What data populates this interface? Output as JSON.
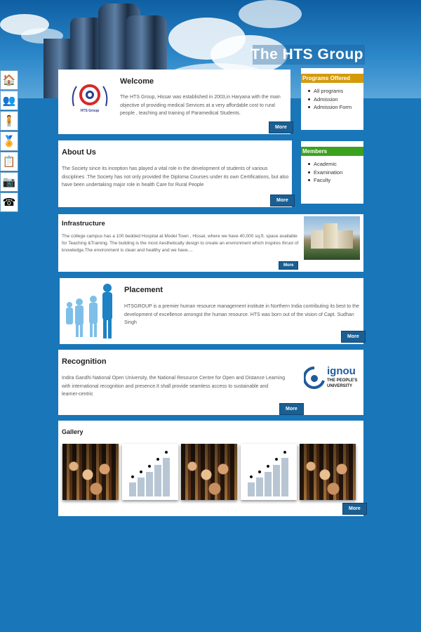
{
  "site": {
    "title": "The HTS Group"
  },
  "left_nav": [
    {
      "icon": "home-icon",
      "glyph": "🏠"
    },
    {
      "icon": "people-icon",
      "glyph": "👥"
    },
    {
      "icon": "person-icon",
      "glyph": "🧍"
    },
    {
      "icon": "award-icon",
      "glyph": "🏅"
    },
    {
      "icon": "clipboard-icon",
      "glyph": "📋"
    },
    {
      "icon": "camera-icon",
      "glyph": "📷"
    },
    {
      "icon": "phone-icon",
      "glyph": "☎"
    }
  ],
  "welcome": {
    "heading": "Welcome",
    "logo_text": "HTS Group",
    "text": "The HTS Group, Hissar was established in 2003,in Haryana with the main objective of providing medical Services at a very affordable cost to rural people , teaching and training of Paramedical Students.",
    "more": "More"
  },
  "about": {
    "heading": "About Us",
    "text": "The Society since its inception has played a vital role in the development of students of various disciplines .The Society has not only provided the Diploma Courses under its own Certifications, but also have been undertaking major role in health Care for Rural People",
    "more": "More"
  },
  "programs": {
    "heading": "Programs Offered",
    "items": [
      "All programs",
      "Admission",
      "Admission Form"
    ]
  },
  "members": {
    "heading": "Members",
    "items": [
      "Academic",
      "Examination",
      "Faculty"
    ]
  },
  "infrastructure": {
    "heading": "Infrastructure",
    "text": "The college campus has a 100 bedded Hospital at Model Town , Hissar, where we have 40,000 sq.ft. space available for Teaching &Training. The building is the most Aesthetically design to create an environment which inspires thrust of knowledge.The environment is clean and healthy and we have....",
    "more": "More"
  },
  "placement": {
    "heading": "Placement",
    "text": "HTSGROUP is a premier human resource management institute in Northern India contributing its best to the development of excellence amongst the human resource. HTS was born out of the vision of Capt. Sudhan Singh",
    "more": "More"
  },
  "recognition": {
    "heading": "Recognition",
    "text": "Indira Gandhi National Open University, the National Resource Centre for Open and Distance Learning with international recognition and presence.It shall provide seamless access to sustainable and learner-centric",
    "logo_main": "ignou",
    "logo_sub1": "THE PEOPLE'S",
    "logo_sub2": "UNIVERSITY",
    "more": "More"
  },
  "gallery": {
    "heading": "Gallery",
    "more": "More"
  },
  "colors": {
    "background": "#1976b8",
    "programs_head": "#d49a0a",
    "members_head": "#3aa21e",
    "button": "#1a5f93"
  }
}
